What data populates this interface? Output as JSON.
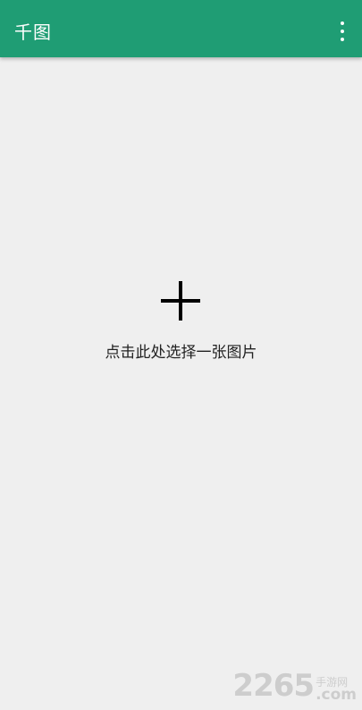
{
  "app_bar": {
    "title": "千图",
    "menu_icon": "more-vert-icon"
  },
  "main": {
    "add_icon": "plus-icon",
    "prompt": "点击此处选择一张图片"
  },
  "watermark": {
    "number": "2265",
    "site_cn": "手游网",
    "domain": ".com"
  },
  "colors": {
    "app_bar": "#1f9d74",
    "background": "#efefef",
    "text": "#222222"
  }
}
